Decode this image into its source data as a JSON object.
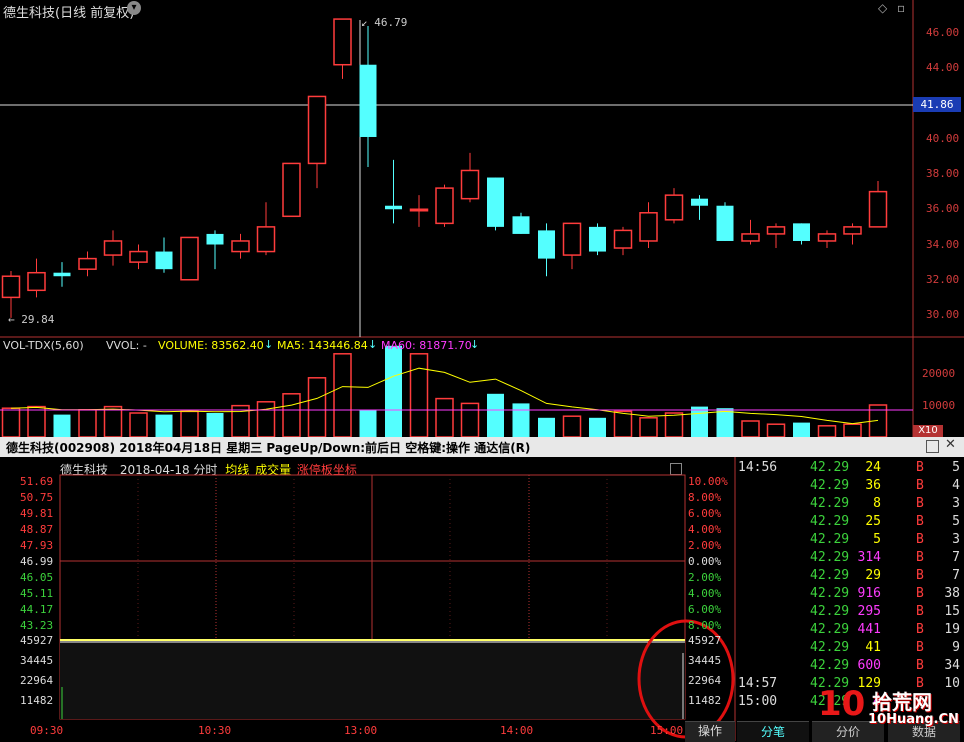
{
  "top": {
    "title": "德生科技(日线 前复权)",
    "high_label": "46.79",
    "low_label": "29.84",
    "crosshair_price": "41.86"
  },
  "price_axis": [
    "46.00",
    "44.00",
    "42.00",
    "40.00",
    "38.00",
    "36.00",
    "34.00",
    "32.00",
    "30.00"
  ],
  "vol": {
    "name": "VOL-TDX(5,60)",
    "vvol": "VVOL: -",
    "volume": "VOLUME: 83562.40",
    "ma5": "MA5: 143446.84",
    "ma60": "MA60: 81871.70",
    "axis": [
      "20000",
      "10000"
    ],
    "unit": "X10"
  },
  "sub": {
    "window_title": "德生科技(002908)  2018年04月18日  星期三  PageUp/Down:前后日  空格键:操作  通达信(R)",
    "header_name": "德生科技",
    "header_date": "2018-04-18 分时",
    "header_avg": "均线",
    "header_vol": "成交量",
    "header_limit": "涨停板坐标",
    "left_prices": [
      "51.69",
      "50.75",
      "49.81",
      "48.87",
      "47.93",
      "46.99",
      "46.05",
      "45.11",
      "44.17",
      "43.23"
    ],
    "right_pcts": [
      "10.00%",
      "8.00%",
      "6.00%",
      "4.00%",
      "2.00%",
      "0.00%",
      "2.00%",
      "4.00%",
      "6.00%",
      "8.00%"
    ],
    "left_vols": [
      "45927",
      "34445",
      "22964",
      "11482"
    ],
    "right_vols": [
      "45927",
      "34445",
      "22964",
      "11482"
    ],
    "time_ticks": [
      "09:30",
      "10:30",
      "13:00",
      "14:00",
      "15:00"
    ],
    "tabs": {
      "op": "操作",
      "fenbi": "分笔",
      "fenjia": "分价",
      "extra": "数据"
    }
  },
  "ticks": [
    {
      "time": "14:56",
      "price": "42.29",
      "vol": "24",
      "side": "B",
      "n": "5",
      "volcolor": "yellow"
    },
    {
      "time": "",
      "price": "42.29",
      "vol": "36",
      "side": "B",
      "n": "4",
      "volcolor": "yellow"
    },
    {
      "time": "",
      "price": "42.29",
      "vol": "8",
      "side": "B",
      "n": "3",
      "volcolor": "yellow"
    },
    {
      "time": "",
      "price": "42.29",
      "vol": "25",
      "side": "B",
      "n": "5",
      "volcolor": "yellow"
    },
    {
      "time": "",
      "price": "42.29",
      "vol": "5",
      "side": "B",
      "n": "3",
      "volcolor": "yellow"
    },
    {
      "time": "",
      "price": "42.29",
      "vol": "314",
      "side": "B",
      "n": "7",
      "volcolor": "magenta"
    },
    {
      "time": "",
      "price": "42.29",
      "vol": "29",
      "side": "B",
      "n": "7",
      "volcolor": "yellow"
    },
    {
      "time": "",
      "price": "42.29",
      "vol": "916",
      "side": "B",
      "n": "38",
      "volcolor": "magenta"
    },
    {
      "time": "",
      "price": "42.29",
      "vol": "295",
      "side": "B",
      "n": "15",
      "volcolor": "magenta"
    },
    {
      "time": "",
      "price": "42.29",
      "vol": "441",
      "side": "B",
      "n": "19",
      "volcolor": "magenta"
    },
    {
      "time": "",
      "price": "42.29",
      "vol": "41",
      "side": "B",
      "n": "9",
      "volcolor": "yellow"
    },
    {
      "time": "",
      "price": "42.29",
      "vol": "600",
      "side": "B",
      "n": "34",
      "volcolor": "magenta"
    },
    {
      "time": "14:57",
      "price": "42.29",
      "vol": "129",
      "side": "B",
      "n": "10",
      "volcolor": "yellow"
    },
    {
      "time": "15:00",
      "price": "42.29",
      "vol": "4",
      "side": "B",
      "n": "",
      "volcolor": "magenta"
    }
  ],
  "watermark": {
    "text": "拾荒网",
    "sub": "10Huang.CN"
  },
  "colors": {
    "up": "#ff3c3c",
    "down": "#54ffff",
    "grid": "#b43232",
    "ma": "#ffff00",
    "ma60": "#ff3cff"
  }
}
